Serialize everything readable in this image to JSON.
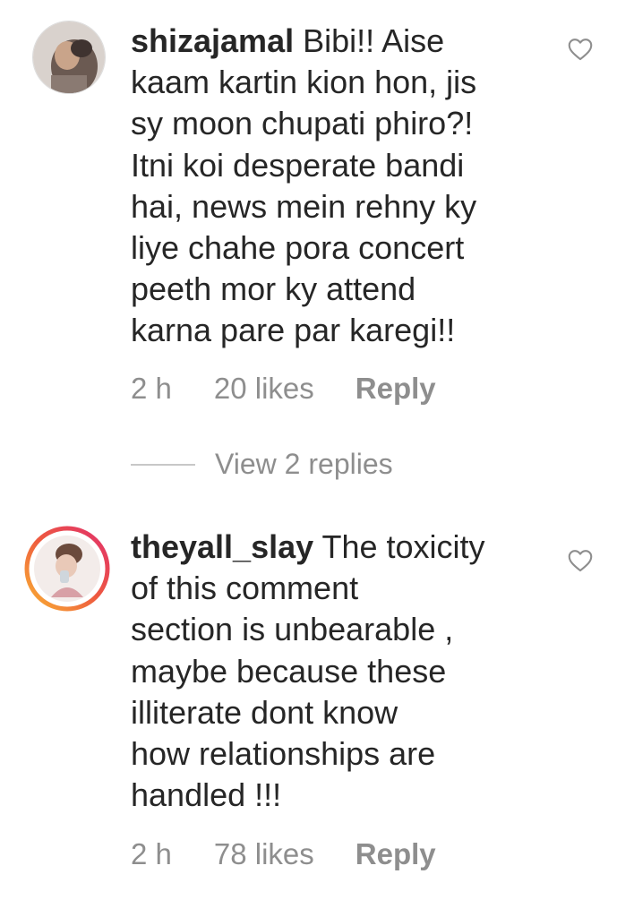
{
  "comments": [
    {
      "username": "shizajamal",
      "text": "Bibi!! Aise\nkaam kartin kion hon, jis\nsy moon chupati phiro?!\nItni koi desperate bandi\nhai, news mein rehny ky\nliye chahe pora concert\npeeth mor ky attend\nkarna pare par karegi!!",
      "time": "2 h",
      "likes": "20 likes",
      "reply": "Reply",
      "avatar_icon": "user-avatar",
      "like_icon": "heart-outline-icon",
      "view_replies": "View 2 replies"
    },
    {
      "username": "theyall_slay",
      "text": "The toxicity\nof this comment\nsection is unbearable ,\nmaybe because these\nilliterate dont know\nhow relationships are\nhandled !!!",
      "time": "2 h",
      "likes": "78 likes",
      "reply": "Reply",
      "avatar_icon": "user-avatar-story-ring",
      "like_icon": "heart-outline-icon"
    }
  ],
  "colors": {
    "text": "#262626",
    "secondary": "#8e8e8e",
    "divider": "#c7c7c7",
    "story_ring_start": "#f9b233",
    "story_ring_end": "#e1306c"
  }
}
